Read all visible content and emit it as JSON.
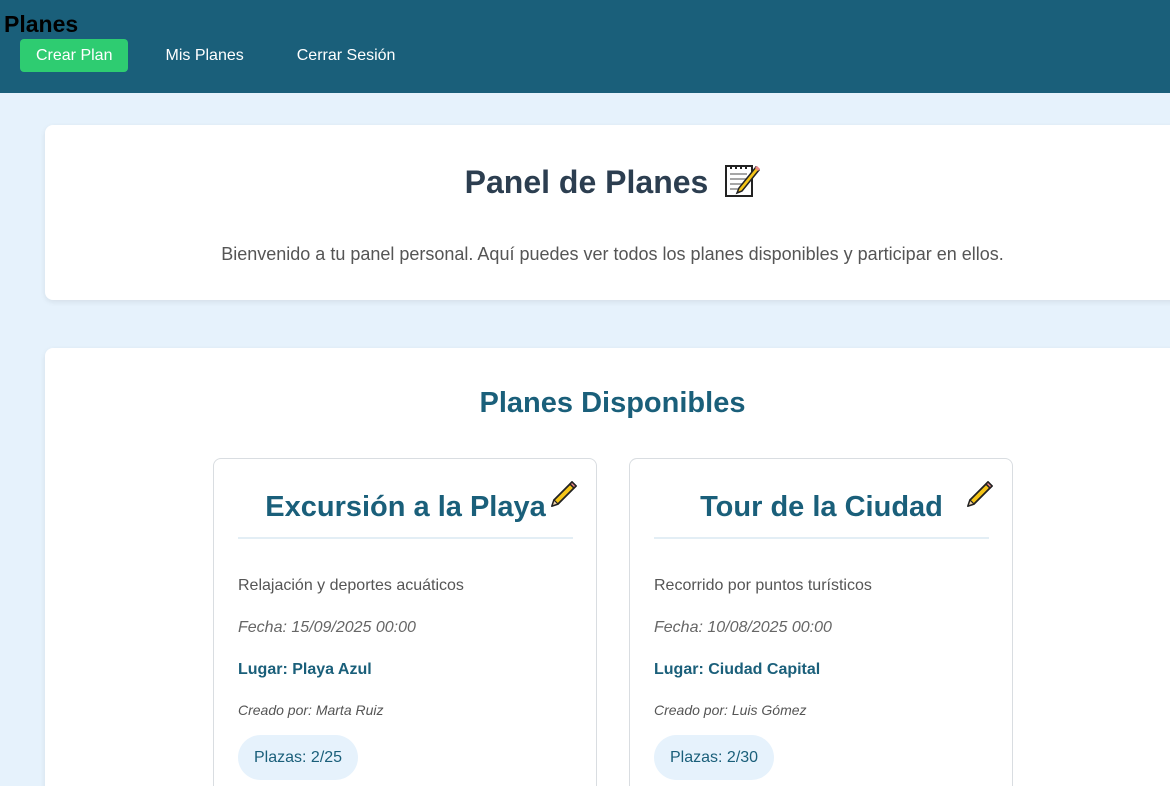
{
  "header": {
    "brand": "Planes",
    "nav": {
      "create": "Crear Plan",
      "mine": "Mis Planes",
      "logout": "Cerrar Sesión"
    }
  },
  "welcome": {
    "title": "Panel de Planes",
    "title_icon": "memo-icon",
    "message": "Bienvenido a tu panel personal. Aquí puedes ver todos los planes disponibles y participar en ellos."
  },
  "available": {
    "heading": "Planes Disponibles",
    "plans": [
      {
        "title": "Excursión a la Playa",
        "edit_icon": "pencil-icon",
        "description": "Relajación y deportes acuáticos",
        "date": "Fecha: 15/09/2025 00:00",
        "place": "Lugar: Playa Azul",
        "creator": "Creado por: Marta Ruiz",
        "spots": "Plazas: 2/25"
      },
      {
        "title": "Tour de la Ciudad",
        "edit_icon": "pencil-icon",
        "description": "Recorrido por puntos turísticos",
        "date": "Fecha: 10/08/2025 00:00",
        "place": "Lugar: Ciudad Capital",
        "creator": "Creado por: Luis Gómez",
        "spots": "Plazas: 2/30"
      }
    ]
  },
  "colors": {
    "header_bg": "#1a5f7a",
    "primary_button": "#2ecc71",
    "page_bg": "#e6f2fc",
    "accent_text": "#1a5f7a"
  }
}
